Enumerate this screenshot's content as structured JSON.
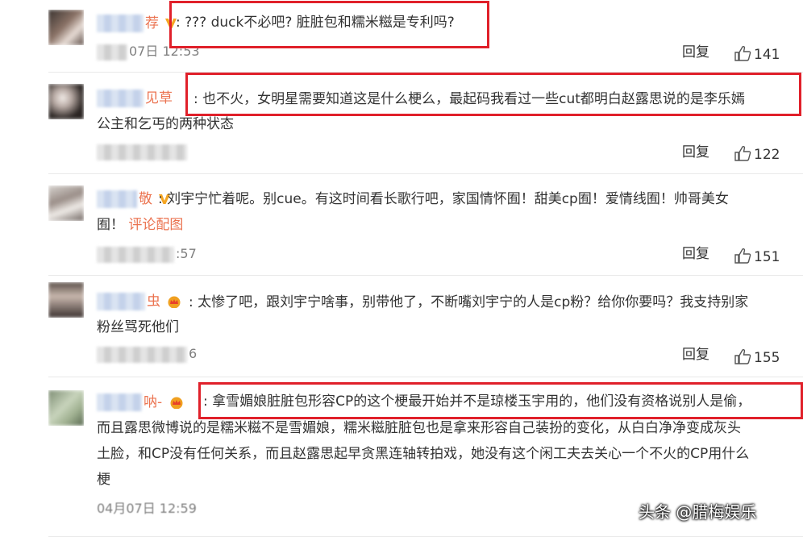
{
  "comments": [
    {
      "name_suffix": "荐",
      "text_lines": [
        ": ??? duck不必吧? 脏脏包和糯米糍是专利吗?"
      ],
      "time": "07日 12:53",
      "reply": "回复",
      "likes": "141",
      "badge": "v"
    },
    {
      "name_suffix": "见草",
      "text_lines": [
        ": 也不火，女明星需要知道这是什么梗么，最起码我看过一些cut都明白赵露思说的是李乐嫣",
        "公主和乞丐的两种状态"
      ],
      "time": "",
      "reply": "回复",
      "likes": "122",
      "badge": ""
    },
    {
      "name_suffix": "敬",
      "text_lines": [
        ": 刘宇宁忙着呢。别cue。有这时间看长歌行吧，家国情怀囿！甜美cp囿！爱情线囿！帅哥美女",
        "囿！"
      ],
      "link": "评论配图",
      "time": ":57",
      "reply": "回复",
      "likes": "151",
      "badge": "v"
    },
    {
      "name_suffix": "虫",
      "text_lines": [
        ": 太惨了吧，跟刘宇宁啥事，别带他了，不断嘴刘宇宁的人是cp粉？给你你要吗？我支持别家",
        "粉丝骂死他们"
      ],
      "time": "6",
      "reply": "回复",
      "likes": "155",
      "badge": "crown"
    },
    {
      "name_suffix": "呐-",
      "text_lines": [
        ": 拿雪媚娘脏脏包形容CP的这个梗最开始并不是琼楼玉宇用的，他们没有资格说别人是偷，",
        "而且露思微博说的是糯米糍不是雪媚娘，糯米糍脏脏包也是拿来形容自己装扮的变化，从白白净净变成灰头",
        "土脸，和CP没有任何关系，而且赵露思起早贪黑连轴转拍戏，她没有这个闲工夫去关心一个不火的CP用什么",
        "梗"
      ],
      "time": "04月07日 12:59",
      "reply": "",
      "likes": "",
      "badge": "crown"
    }
  ],
  "watermark": "头条 @腊梅娱乐",
  "colors": {
    "name": "#eb7350",
    "text": "#333333",
    "meta": "#808080",
    "highlight": "#e0202a"
  },
  "icons": {
    "verified": "orange-v-icon",
    "vip": "crown-icon",
    "like": "thumb-up-icon"
  }
}
